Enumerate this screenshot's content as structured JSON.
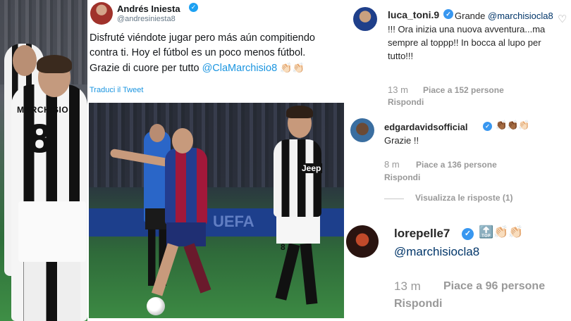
{
  "tweet": {
    "author_name": "Andrés Iniesta",
    "author_handle": "@andresiniesta8",
    "body_line1": "Disfruté viéndote jugar pero más aún compitiendo",
    "body_line2": "contra ti. Hoy el fútbol es un poco menos fútbol.",
    "body_line3_prefix": "Grazie di cuore per tutto ",
    "body_mention": "@ClaMarchisio8",
    "body_emoji": "👏🏻👏🏻",
    "translate_link": "Traduci il Tweet",
    "verified_glyph": "✓"
  },
  "left_photo": {
    "shirt_name": "MARCHISIO",
    "shirt_number": "8"
  },
  "tweet_photo": {
    "sponsor": "Jeep",
    "board_text": "UEFA",
    "shorts_number": "8"
  },
  "comments": [
    {
      "username": "luca_toni.9",
      "text_prefix": "Grande",
      "mention": "@marchisiocla8",
      "text_suffix": "!!! Ora inizia una nuova avventura...ma sempre al toppp!! In bocca al lupo per tutto!!!",
      "time": "13 m",
      "likes": "Piace a 152 persone",
      "reply": "Rispondi"
    },
    {
      "username": "edgardavidsofficial",
      "emoji": "👏🏾👏🏾👏🏻",
      "text": "Grazie !!",
      "time": "8 m",
      "likes": "Piace a 136 persone",
      "reply": "Rispondi",
      "view_replies": "Visualizza le risposte (1)"
    },
    {
      "username": "lorepelle7",
      "emoji": "🔝👏🏻👏🏻",
      "mention": "@marchisiocla8",
      "time": "13 m",
      "likes": "Piace a 96 persone",
      "reply": "Rispondi"
    }
  ],
  "icons": {
    "heart": "♡",
    "verified": "✓"
  },
  "colors": {
    "twitter_link": "#1b95e0",
    "instagram_verified": "#3897f0",
    "instagram_mention": "#003569",
    "meta_gray": "#999999"
  }
}
